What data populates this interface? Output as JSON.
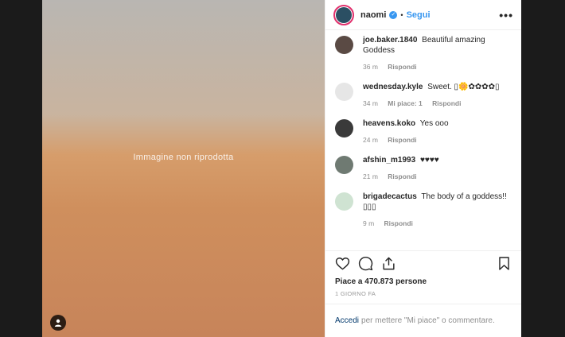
{
  "media": {
    "note": "Immagine non riprodotta"
  },
  "header": {
    "username": "naomi",
    "verified_mark": "✓",
    "separator": "•",
    "follow_label": "Segui",
    "more_label": "•••"
  },
  "comments": [
    {
      "user": "joe.baker.1840",
      "text": "Beautiful amazing Goddess",
      "time": "36 m",
      "likes": "",
      "reply": "Rispondi",
      "avatar_color": "#5a4a44"
    },
    {
      "user": "wednesday.kyle",
      "text": "Sweet. ▯🌼✿✿✿✿▯",
      "time": "34 m",
      "likes": "Mi piace: 1",
      "reply": "Rispondi",
      "avatar_color": "#e6e6e6"
    },
    {
      "user": "heavens.koko",
      "text": "Yes ooo",
      "time": "24 m",
      "likes": "",
      "reply": "Rispondi",
      "avatar_color": "#3a3a3a"
    },
    {
      "user": "afshin_m1993",
      "text": "♥♥♥♥",
      "time": "21 m",
      "likes": "",
      "reply": "Rispondi",
      "avatar_color": "#6f7a72"
    },
    {
      "user": "brigadecactus",
      "text": "The body of a goddess!! ▯▯▯",
      "time": "9 m",
      "likes": "",
      "reply": "Rispondi",
      "avatar_color": "#cfe3d2"
    }
  ],
  "icons": {
    "like": "heart-icon",
    "comment": "comment-icon",
    "share": "share-icon",
    "save": "bookmark-icon",
    "tag": "user-tag-icon"
  },
  "post": {
    "likes_text": "Piace a 470.873 persone",
    "time_text": "1 GIORNO FA"
  },
  "login_prompt": {
    "link": "Accedi",
    "text": "per mettere \"Mi piace\" o commentare."
  },
  "colors": {
    "accent": "#3897f0",
    "text": "#262626",
    "muted": "#8e8e8e",
    "border": "#efefef"
  }
}
